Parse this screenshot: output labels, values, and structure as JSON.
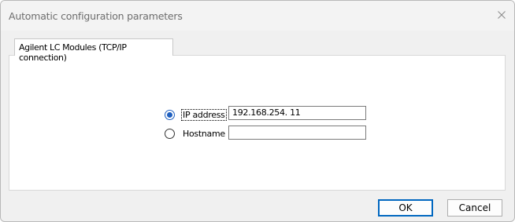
{
  "window": {
    "title": "Automatic configuration parameters",
    "close_icon": "close-icon"
  },
  "tab": {
    "label": "Agilent LC Modules (TCP/IP connection)"
  },
  "connection": {
    "ip_option": {
      "label": "IP address",
      "checked": true
    },
    "ip_value": "192.168.254.  11",
    "hostname_option": {
      "label": "Hostname",
      "checked": false
    },
    "hostname_value": ""
  },
  "buttons": {
    "ok": "OK",
    "cancel": "Cancel"
  },
  "colors": {
    "accent": "#0067c0",
    "radio_selected": "#1f5fbf",
    "background": "#f0f0f0"
  }
}
